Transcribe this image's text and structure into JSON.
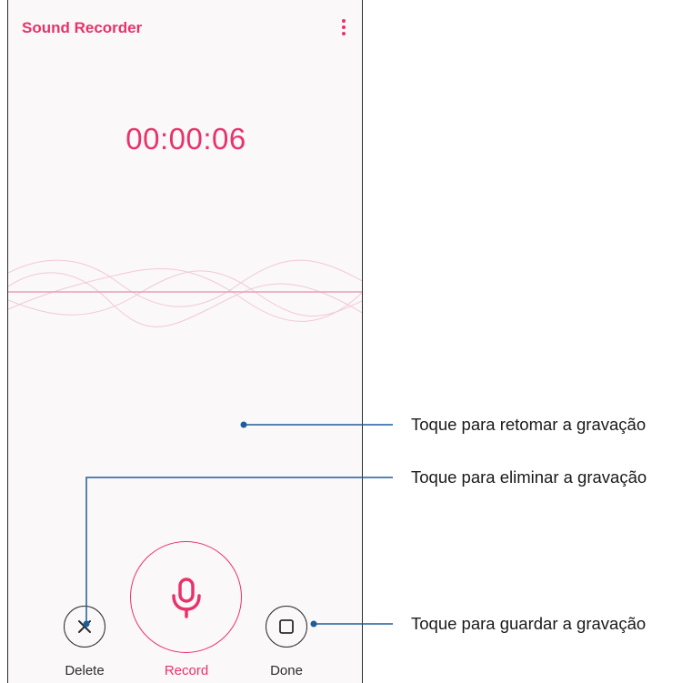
{
  "app": {
    "title": "Sound Recorder",
    "menu_icon": "more-vert-icon",
    "accent_color": "#e8336a"
  },
  "recorder": {
    "elapsed_time": "00:00:06"
  },
  "controls": {
    "delete_label": "Delete",
    "record_label": "Record",
    "done_label": "Done",
    "delete_icon": "close-icon",
    "record_icon": "microphone-icon",
    "done_icon": "stop-icon"
  },
  "callouts": {
    "delete": "Toque para eliminar a gravação",
    "record": "Toque para retomar a gravação",
    "done": "Toque para guardar a gravação",
    "line_color": "#1f5c9e"
  }
}
